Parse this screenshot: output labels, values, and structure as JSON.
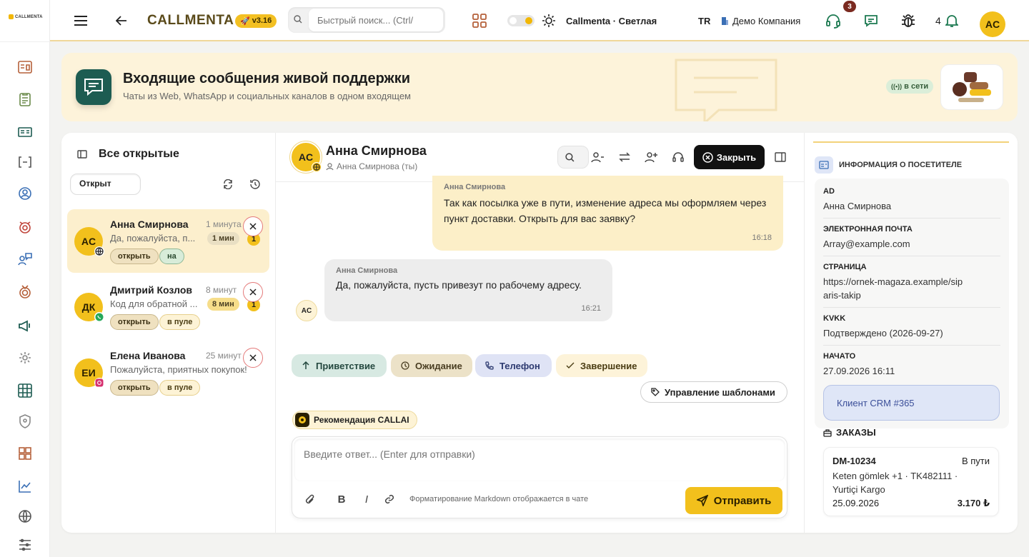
{
  "sidebar": {
    "logo_text": "CALLMENTA",
    "items": [
      "dashboard-icon",
      "clipboard-icon",
      "id-card-icon",
      "brackets-icon",
      "user-circle-icon",
      "alarm-icon",
      "user-chat-icon",
      "medal-icon",
      "megaphone-icon",
      "settings-gear-icon",
      "grid-icon",
      "shield-icon",
      "boxes-icon",
      "chart-icon",
      "globe-icon",
      "sliders-icon"
    ]
  },
  "topbar": {
    "brand": "CALLMENTA",
    "version": "v3.16",
    "search_placeholder": "Быстрый поиск... (Ctrl/",
    "theme_label": "Callmenta · Светлая",
    "language": "TR",
    "company": "Демо Компания",
    "chat_badge": "3",
    "notifications_count": "4",
    "user_initials": "AC"
  },
  "banner": {
    "title": "Входящие сообщения живой поддержки",
    "subtitle": "Чаты из Web, WhatsApp и социальных каналов в одном входящем",
    "status": "в сети"
  },
  "list": {
    "title": "Все открытые",
    "status_filter": "Открыт",
    "conversations": [
      {
        "initials": "AC",
        "name": "Анна Смирнова",
        "time": "1 минута",
        "preview": "Да, пожалуйста, п...",
        "duration": "1 мин",
        "unread": "1",
        "status": "открыть",
        "tag": "на",
        "channel": "web"
      },
      {
        "initials": "ДК",
        "name": "Дмитрий Козлов",
        "time": "8 минут",
        "preview": "Код для обратной ...",
        "duration": "8 мин",
        "unread": "1",
        "status": "открыть",
        "tag": "в пуле",
        "channel": "whatsapp"
      },
      {
        "initials": "ЕИ",
        "name": "Елена Иванова",
        "time": "25 минут",
        "preview": "Пожалуйста, приятных покупок!",
        "duration": "",
        "unread": "",
        "status": "открыть",
        "tag": "в пуле",
        "channel": "instagram"
      }
    ]
  },
  "chat": {
    "initials": "AC",
    "name": "Анна Смирнова",
    "assigned": "Анна Смирнова (ты)",
    "close_label": "Закрыть",
    "messages": [
      {
        "sender": "Анна Смирнова",
        "text": "Так как посылка уже в пути, изменение адреса мы оформляем через пункт доставки. Открыть для вас заявку?",
        "time": "16:18",
        "side": "agent"
      },
      {
        "sender": "Анна Смирнова",
        "text": "Да, пожалуйста, пусть привезут по рабочему адресу.",
        "time": "16:21",
        "side": "visitor",
        "initials": "AC"
      }
    ],
    "quick_replies": [
      "Приветствие",
      "Ожидание",
      "Телефон",
      "Завершение"
    ],
    "templates_label": "Управление шаблонами",
    "ai_label": "Рекомендация CALLAI",
    "reply_placeholder": "Введите ответ... (Enter для отправки)",
    "markdown_hint": "Форматирование Markdown отображается в чате",
    "send_label": "Отправить"
  },
  "info": {
    "title": "ИНФОРМАЦИЯ О ПОСЕТИТЕЛЕ",
    "fields": [
      {
        "label": "AD",
        "value": "Анна Смирнова"
      },
      {
        "label": "ЭЛЕКТРОННАЯ ПОЧТА",
        "value": "Array@example.com"
      },
      {
        "label": "СТРАНИЦА",
        "value": "https://ornek-magaza.example/siparis-takip"
      },
      {
        "label": "KVKK",
        "value": "Подтверждено (2026-09-27)"
      },
      {
        "label": "НАЧАТО",
        "value": "27.09.2026 16:11"
      }
    ],
    "crm": "Клиент CRM #365",
    "orders_title": "ЗАКАЗЫ",
    "order": {
      "id": "DM-10234",
      "status": "В пути",
      "details": "Keten gömlek +1 · TK482111 · Yurtiçi Kargo",
      "date": "25.09.2026",
      "total": "3.170 ₺"
    }
  },
  "colors": {
    "accent": "#f2c01c",
    "brand_dark": "#1d5c52",
    "close_bg": "#111111",
    "banner_bg": "#fdf3da"
  }
}
